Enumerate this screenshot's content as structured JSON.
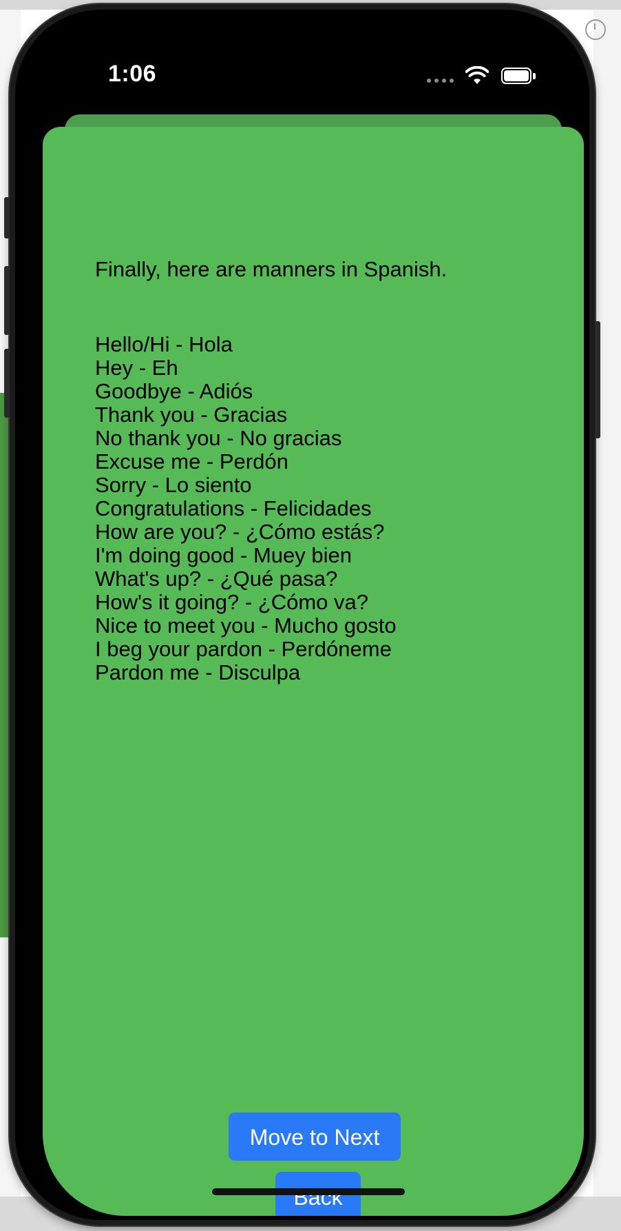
{
  "status_bar": {
    "time": "1:06"
  },
  "screen": {
    "intro": "Finally, here are manners in Spanish.",
    "phrases": [
      "Hello/Hi - Hola",
      "Hey - Eh",
      "Goodbye - Adiós",
      "Thank you - Gracias",
      "No thank you - No gracias",
      "Excuse me - Perdón",
      "Sorry - Lo siento",
      "Congratulations - Felicidades",
      "How are you? - ¿Cómo estás?",
      "I'm doing good - Muey bien",
      "What's up? - ¿Qué pasa?",
      "How's it going? - ¿Cómo va?",
      "Nice to meet you - Mucho gosto",
      "I beg your pardon - Perdóneme",
      "Pardon me - Disculpa"
    ],
    "next_button": "Move to Next",
    "back_button": "Back"
  },
  "colors": {
    "sheet_background": "#56ba56",
    "button_background": "#2a79f6",
    "text": "#000000"
  },
  "icons": [
    "wifi-icon",
    "battery-icon",
    "cellular-dots-icon"
  ]
}
